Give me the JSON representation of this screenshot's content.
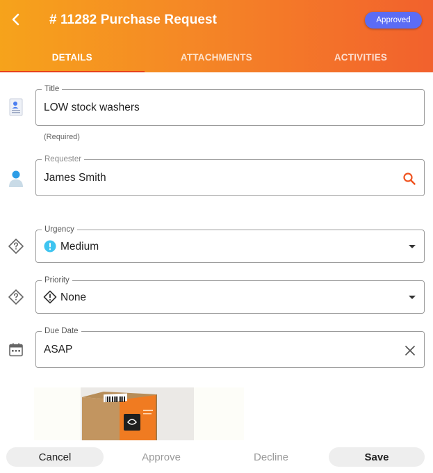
{
  "header": {
    "title": "# 11282 Purchase Request",
    "status": "Approved",
    "back_icon": "chevron-left-icon",
    "colors": {
      "gradient_start": "#f6a31b",
      "gradient_end": "#f2612d",
      "badge": "#5b6cf5",
      "tab_indicator": "#e8421b"
    }
  },
  "tabs": [
    {
      "label": "DETAILS",
      "active": true
    },
    {
      "label": "ATTACHMENTS",
      "active": false
    },
    {
      "label": "ACTIVITIES",
      "active": false
    }
  ],
  "form": {
    "title": {
      "label": "Title",
      "value": "LOW stock washers",
      "helper": "(Required)",
      "icon": "document-person-icon"
    },
    "requester": {
      "label": "Requester",
      "value": "James Smith",
      "icon": "person-icon",
      "action_icon": "search-icon"
    },
    "urgency": {
      "label": "Urgency",
      "value": "Medium",
      "icon": "question-diamond-icon",
      "value_icon": "exclamation-circle-icon",
      "action_icon": "dropdown-arrow-icon"
    },
    "priority": {
      "label": "Priority",
      "value": "None",
      "icon": "question-diamond-icon",
      "value_icon": "exclamation-diamond-icon",
      "action_icon": "dropdown-arrow-icon"
    },
    "due_date": {
      "label": "Due Date",
      "value": "ASAP",
      "icon": "calendar-icon",
      "action_icon": "clear-icon"
    }
  },
  "footer": {
    "cancel": "Cancel",
    "approve": "Approve",
    "decline": "Decline",
    "save": "Save"
  }
}
